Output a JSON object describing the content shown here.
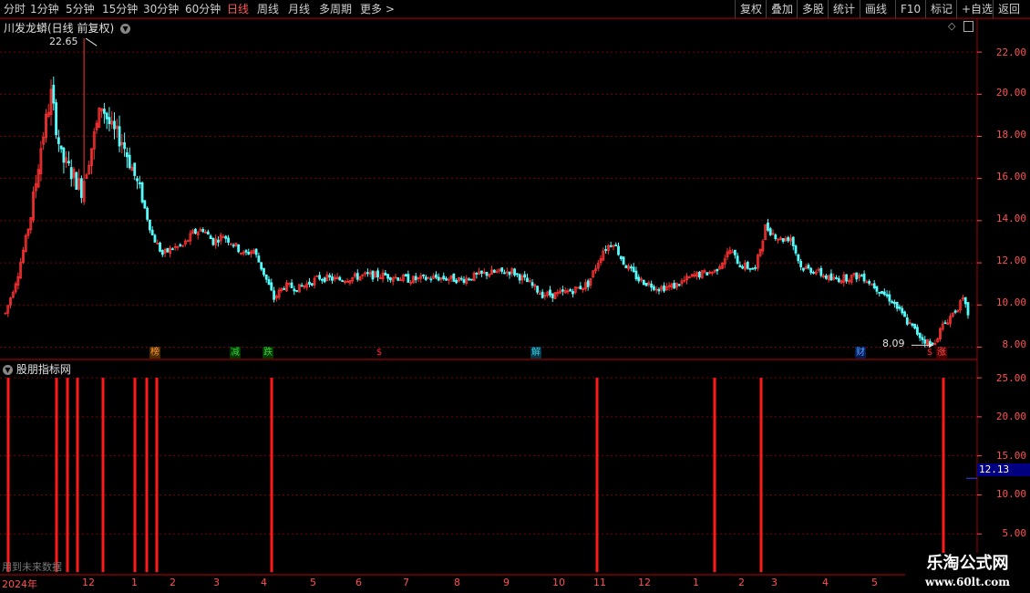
{
  "toolbar": {
    "periods": [
      {
        "label": "分时",
        "active": false
      },
      {
        "label": "1分钟",
        "active": false
      },
      {
        "label": "5分钟",
        "active": false
      },
      {
        "label": "15分钟",
        "active": false
      },
      {
        "label": "30分钟",
        "active": false
      },
      {
        "label": "60分钟",
        "active": false
      },
      {
        "label": "日线",
        "active": true
      },
      {
        "label": "周线",
        "active": false
      },
      {
        "label": "月线",
        "active": false
      },
      {
        "label": "多周期",
        "active": false
      },
      {
        "label": "更多",
        "active": false
      }
    ],
    "right_buttons": [
      "复权",
      "叠加",
      "多股",
      "统计",
      "画线",
      "F10",
      "标记",
      "+自选",
      "返回"
    ]
  },
  "main_panel": {
    "title": "川发龙蟒(日线 前复权)",
    "high_label": "22.65",
    "low_label": "8.09",
    "y_ticks": [
      "22.00",
      "20.00",
      "18.00",
      "16.00",
      "14.00",
      "12.00",
      "10.00",
      "8.00"
    ],
    "event_badges": [
      {
        "text": "榜",
        "color": "#ff9a2e"
      },
      {
        "text": "减",
        "color": "#3ccf3c"
      },
      {
        "text": "跌",
        "color": "#3ccf3c"
      },
      {
        "text": "$",
        "color": "#ff3030"
      },
      {
        "text": "解",
        "color": "#40c8e0"
      },
      {
        "text": "财",
        "color": "#3a7bff"
      },
      {
        "text": "$",
        "color": "#ff3030"
      },
      {
        "text": "涨",
        "color": "#ff3030"
      }
    ]
  },
  "indicator_panel": {
    "title": "股朋指标网",
    "y_ticks": [
      "25.00",
      "20.00",
      "15.00",
      "10.00",
      "5.00"
    ],
    "current_value": "12.13",
    "footnote": "用到未来数据"
  },
  "time_axis": {
    "labels": [
      "2024年",
      "12",
      "1",
      "2",
      "3",
      "4",
      "5",
      "6",
      "7",
      "8",
      "9",
      "10",
      "11",
      "12",
      "1",
      "2",
      "3",
      "4",
      "5"
    ]
  },
  "watermark": {
    "line1": "乐淘公式网",
    "line2": "www.60lt.com"
  },
  "colors": {
    "up": "#ff3232",
    "down": "#54fcfc",
    "axis": "#ff5050",
    "grid": "#7a0000",
    "signal": "#ff1a1a"
  },
  "chart_data": {
    "type": "candlestick",
    "ylim": [
      7.5,
      23.0
    ],
    "notable": {
      "high": 22.65,
      "low": 8.09
    },
    "signal_bars_value": 25.0,
    "indicator_ylim": [
      0,
      27
    ]
  }
}
